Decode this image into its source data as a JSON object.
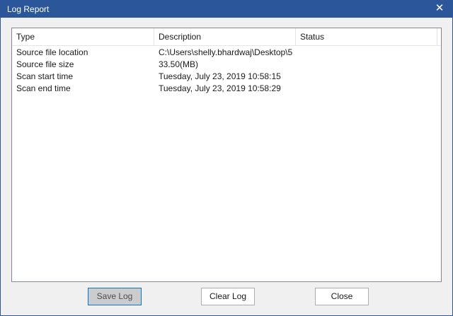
{
  "window": {
    "title": "Log Report",
    "close_glyph": "✕"
  },
  "table": {
    "columns": [
      "Type",
      "Description",
      "Status"
    ],
    "rows": [
      {
        "type": "Source file location",
        "description": "C:\\Users\\shelly.bhardwaj\\Desktop\\5...",
        "status": ""
      },
      {
        "type": "Source file size",
        "description": "33.50(MB)",
        "status": ""
      },
      {
        "type": "Scan start time",
        "description": "Tuesday, July 23, 2019 10:58:15",
        "status": ""
      },
      {
        "type": "Scan end time",
        "description": "Tuesday, July 23, 2019 10:58:29",
        "status": ""
      }
    ]
  },
  "buttons": {
    "save_label": "Save Log",
    "clear_label": "Clear Log",
    "close_label": "Close"
  },
  "colors": {
    "titlebar": "#2b579a",
    "dialog_bg": "#f0f0f0"
  }
}
